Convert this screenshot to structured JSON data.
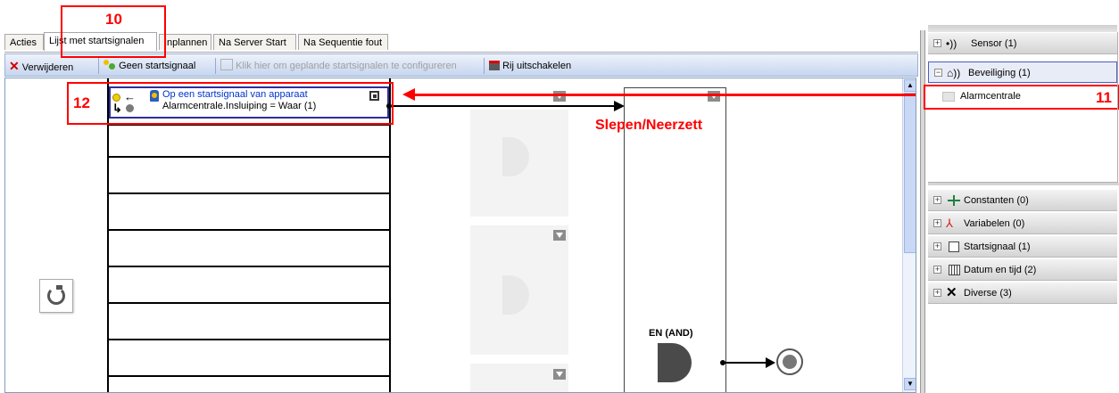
{
  "tabs": [
    "Acties",
    "Lijst met startsignalen",
    "Inplannen",
    "Na Server Start",
    "Na Sequentie fout"
  ],
  "toolbar": {
    "delete_label": "Verwijderen",
    "no_signal_label": "Geen startsignaal",
    "configure_label": "Klik hier om geplande startsignalen te configureren",
    "disable_row_label": "Rij uitschakelen"
  },
  "trigger": {
    "title": "Op een startsignaal van apparaat",
    "condition": "Alarmcentrale.Insluiping = Waar (1)"
  },
  "gate_label": "EN (AND)",
  "drag_label": "Slepen/Neerzett",
  "callouts": {
    "c10": "10",
    "c11": "11",
    "c12": "12"
  },
  "tree": {
    "sensor": "Sensor (1)",
    "security": "Beveiliging (1)",
    "alarm": "Alarmcentrale"
  },
  "groups": [
    "Constanten (0)",
    "Variabelen (0)",
    "Startsignaal (1)",
    "Datum en tijd (2)",
    "Diverse (3)"
  ],
  "colors": {
    "accent_red": "#ff0000",
    "link_blue": "#0033cc",
    "selection_border": "#2d2d9f"
  }
}
